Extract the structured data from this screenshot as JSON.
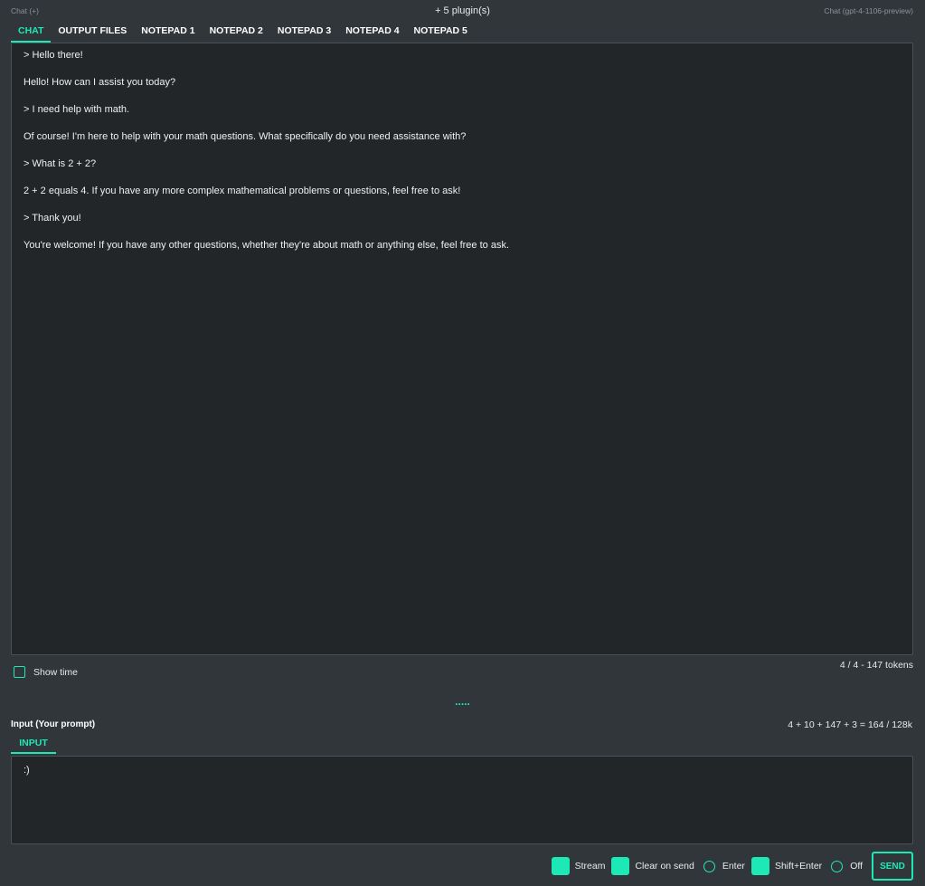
{
  "header": {
    "left_label": "Chat (+)",
    "center_label": "+ 5 plugin(s)",
    "right_label": "Chat (gpt-4-1106-preview)"
  },
  "tabs": [
    {
      "label": "CHAT",
      "active": true
    },
    {
      "label": "OUTPUT FILES",
      "active": false
    },
    {
      "label": "NOTEPAD 1",
      "active": false
    },
    {
      "label": "NOTEPAD 2",
      "active": false
    },
    {
      "label": "NOTEPAD 3",
      "active": false
    },
    {
      "label": "NOTEPAD 4",
      "active": false
    },
    {
      "label": "NOTEPAD 5",
      "active": false
    }
  ],
  "chat": {
    "messages": [
      "> Hello there!",
      "Hello! How can I assist you today?",
      "> I need help with math.",
      "Of course! I'm here to help with your math questions. What specifically do you need assistance with?",
      "> What is 2 + 2?",
      "2 + 2 equals 4. If you have any more complex mathematical problems or questions, feel free to ask!",
      "> Thank you!",
      "You're welcome! If you have any other questions, whether they're about math or anything else, feel free to ask."
    ]
  },
  "show_time": {
    "label": "Show time",
    "checked": false
  },
  "token_count": "4 / 4 - 147 tokens",
  "splitter": ".....",
  "input_section": {
    "title": "Input (Your prompt)",
    "stats": "4 + 10 + 147 + 3 = 164 / 128k",
    "tab_label": "INPUT",
    "value": ":)"
  },
  "controls": {
    "stream": {
      "label": "Stream",
      "checked": true
    },
    "clear_on_send": {
      "label": "Clear on send",
      "checked": true
    },
    "enter": {
      "label": "Enter",
      "selected": false
    },
    "shift_enter": {
      "label": "Shift+Enter",
      "checked": true
    },
    "off": {
      "label": "Off",
      "selected": false
    },
    "send_label": "SEND"
  },
  "colors": {
    "accent": "#1de9b6",
    "background": "#31363b",
    "panel": "#232629"
  }
}
